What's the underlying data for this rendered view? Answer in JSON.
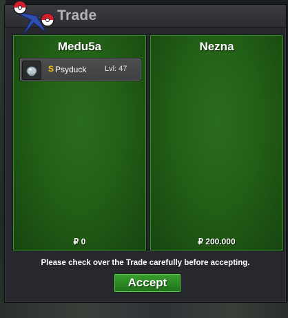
{
  "window": {
    "title": "Trade",
    "logo_icon": "pokeball-logo-icon"
  },
  "left_panel": {
    "player_name": "Medu5a",
    "items": [
      {
        "icon": "pokemon-sprite-icon",
        "coin_symbol": "S",
        "name": "Psyduck",
        "level": "Lvl: 47"
      }
    ],
    "money": "₽ 0"
  },
  "right_panel": {
    "player_name": "Nezna",
    "items": [],
    "money": "₽ 200.000"
  },
  "footer": {
    "notice": "Please check over the Trade carefully before accepting.",
    "accept_label": "Accept"
  },
  "colors": {
    "panel_green": "#226016",
    "accept_green": "#2c8a24",
    "coin_gold": "#f2c21b"
  }
}
